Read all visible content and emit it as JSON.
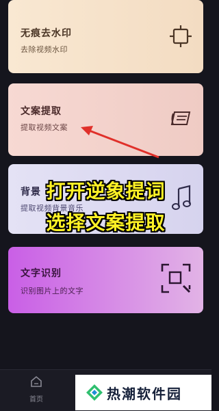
{
  "cards": [
    {
      "title": "无痕去水印",
      "subtitle": "去除视频水印",
      "icon": "crop-frame-icon"
    },
    {
      "title": "文案提取",
      "subtitle": "提取视频文案",
      "icon": "quill-note-icon"
    },
    {
      "title": "背景",
      "subtitle": "提取视频背景音乐",
      "icon": "music-note-icon"
    },
    {
      "title": "文字识别",
      "subtitle": "识别图片上的文字",
      "icon": "scan-search-icon"
    }
  ],
  "overlay": {
    "line1": "打开逆象提词",
    "line2": "选择文案提取"
  },
  "nav": {
    "home_label": "首页"
  },
  "watermark": {
    "text": "热潮软件园"
  },
  "colors": {
    "overlay_text": "#fff225",
    "arrow": "#e0302a",
    "background": "#15151d"
  }
}
